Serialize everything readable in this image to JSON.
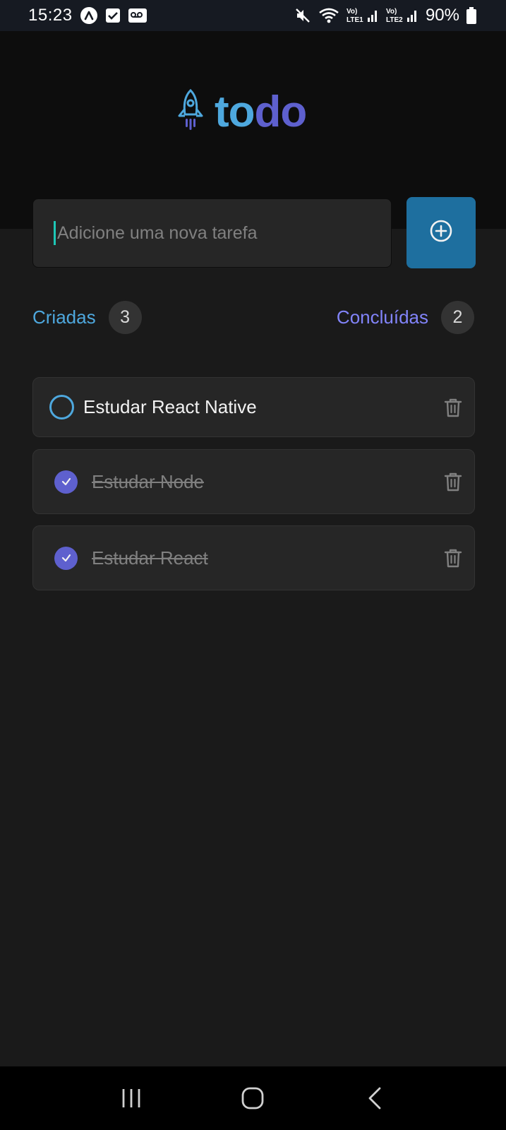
{
  "status_bar": {
    "time": "15:23",
    "battery": "90%",
    "network_1": "LTE1",
    "network_2": "LTE2"
  },
  "app": {
    "logo_part1": "to",
    "logo_part2": "do"
  },
  "input": {
    "placeholder": "Adicione uma nova tarefa"
  },
  "counters": {
    "created_label": "Criadas",
    "created_count": "3",
    "done_label": "Concluídas",
    "done_count": "2"
  },
  "tasks": [
    {
      "title": "Estudar React Native",
      "done": false
    },
    {
      "title": "Estudar Node",
      "done": true
    },
    {
      "title": "Estudar React",
      "done": true
    }
  ],
  "colors": {
    "blue": "#4ea8de",
    "purple": "#5e60ce",
    "purple_light": "#8284fa",
    "button": "#1e6f9f",
    "background": "#1a1a1a",
    "header": "#0d0d0d",
    "card": "#262626"
  },
  "icons": {
    "logo": "rocket-icon",
    "add": "plus-circle-icon",
    "delete": "trash-icon",
    "checked": "check-circle-icon",
    "unchecked": "circle-icon"
  }
}
